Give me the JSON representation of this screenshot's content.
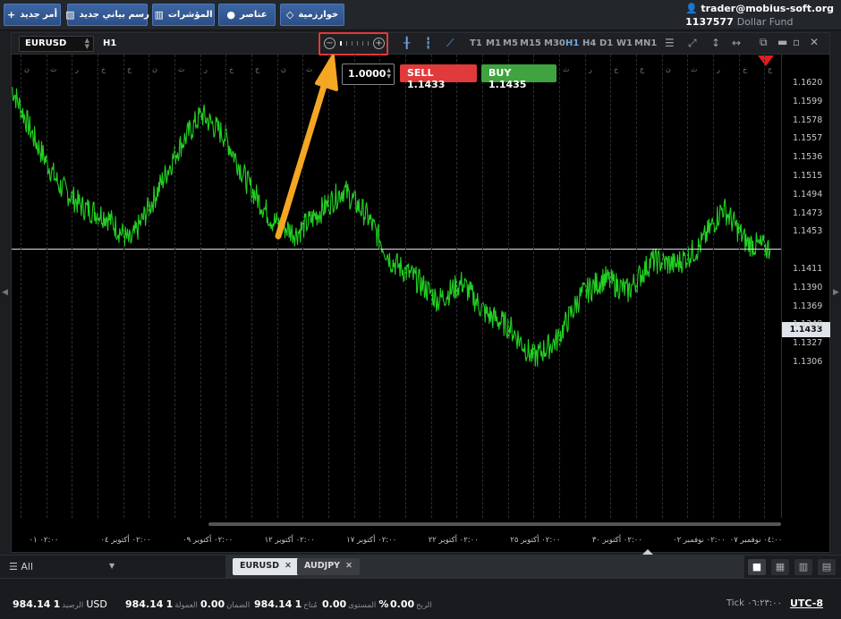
{
  "toolbar": {
    "new_order": "أمر جديد",
    "new_chart": "رسم بياني جديد",
    "indicators": "المؤشرات",
    "elements": "عناصر",
    "algorithms": "خوارزمية"
  },
  "account": {
    "user": "trader@mobius-soft.org",
    "number": "1137577",
    "fund": "Dollar Fund"
  },
  "chart": {
    "symbol": "EURUSD",
    "timeframe": "H1",
    "timeframes": [
      "T1",
      "M1",
      "M5",
      "M15",
      "M30",
      "H1",
      "H4",
      "D1",
      "W1",
      "MN1"
    ],
    "active_timeframe": "H1",
    "lot": "1.0000",
    "sell_label": "SELL",
    "sell_price": "1.1433",
    "buy_label": "BUY",
    "buy_price": "1.1435",
    "current_price": "1.1433",
    "y_ticks": [
      "1.1620",
      "1.1599",
      "1.1578",
      "1.1557",
      "1.1536",
      "1.1515",
      "1.1494",
      "1.1473",
      "1.1453",
      "1.1433",
      "1.1411",
      "1.1390",
      "1.1369",
      "1.1348",
      "1.1327",
      "1.1306"
    ],
    "x_ticks": [
      "٠٢:٠٠ ٠١",
      "٠٢:٠٠ أكتوبر ٠٤",
      "٠٢:٠٠ أكتوبر ٠٩",
      "٠٢:٠٠ أكتوبر ١٢",
      "٠٢:٠٠ أكتوبر ١٧",
      "٠٢:٠٠ أكتوبر ٢٢",
      "٠٢:٠٠ أكتوبر ٢٥",
      "٠٢:٠٠ أكتوبر ٣٠",
      "٠٢:٠٠ نوفمبر ٠٢",
      "٠٤:٠٠ نوفمبر ٠٧"
    ],
    "weekday_marks": [
      "ن",
      "ث",
      "ر",
      "خ",
      "ج",
      "ن",
      "ث",
      "ر",
      "خ",
      "ج",
      "ن",
      "ث",
      "ر",
      "خ",
      "ج",
      "ن",
      "ث",
      "ر",
      "خ",
      "ج",
      "ن",
      "ث",
      "ر",
      "خ",
      "ج",
      "ن",
      "ث",
      "ر",
      "خ",
      "ج"
    ]
  },
  "chart_data": {
    "type": "line",
    "title": "",
    "series": [
      {
        "name": "EURUSD",
        "color": "#22d022"
      }
    ],
    "ylim": [
      1.1295,
      1.165
    ],
    "x": [
      "01",
      "04 أكتوبر",
      "09 أكتوبر",
      "12 أكتوبر",
      "17 أكتوبر",
      "22 أكتوبر",
      "25 أكتوبر",
      "30 أكتوبر",
      "02 نوفمبر",
      "07 نوفمبر"
    ],
    "values": [
      1.1615,
      1.1555,
      1.1505,
      1.148,
      1.147,
      1.144,
      1.149,
      1.1545,
      1.1585,
      1.156,
      1.1505,
      1.1465,
      1.145,
      1.1475,
      1.15,
      1.147,
      1.142,
      1.14,
      1.1375,
      1.1395,
      1.136,
      1.1345,
      1.131,
      1.133,
      1.138,
      1.14,
      1.1385,
      1.142,
      1.1415,
      1.1435,
      1.148,
      1.144,
      1.1433
    ],
    "last_price": 1.1433,
    "grid": true
  },
  "tabs": {
    "filter": "All",
    "items": [
      {
        "label": "EURUSD",
        "active": true
      },
      {
        "label": "AUDJPY",
        "active": false
      }
    ]
  },
  "status": {
    "balance_value": "984.14",
    "balance_num": "1",
    "balance_label": "الرصيد",
    "currency": "USD",
    "equity_value": "984.14",
    "equity_num": "1",
    "equity_label": "العمولة",
    "margin_value": "0.00",
    "margin_label": "الضمان",
    "free_value": "984.14",
    "free_num": "1",
    "free_label": "مُتاح",
    "level_value": "0.00",
    "level_label": "المستوى",
    "percent": "%",
    "profit_value": "0.00",
    "profit_label": "الربح",
    "tick_label": "Tick",
    "time": "٠٦:٢٣:٠٠",
    "timezone": "UTC-8"
  }
}
